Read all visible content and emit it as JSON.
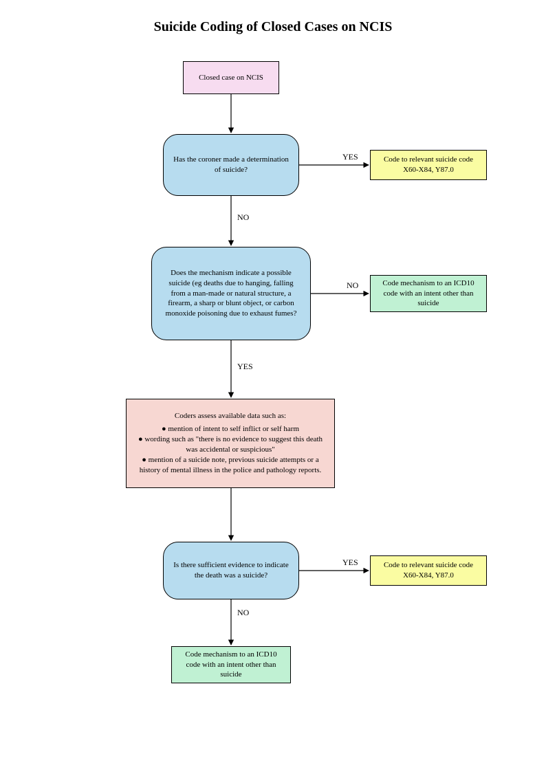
{
  "title": "Suicide Coding of Closed Cases on NCIS",
  "nodes": {
    "start": "Closed case on NCIS",
    "q1": "Has the coroner made a determination of suicide?",
    "r1": "Code to relevant suicide code X60-X84, Y87.0",
    "q2": "Does the mechanism indicate a possible suicide (eg deaths due to hanging, falling from a man-made or natural structure, a firearm, a sharp or blunt object, or carbon monoxide poisoning due to exhaust fumes?",
    "r2": "Code mechanism to an ICD10 code with an intent other than suicide",
    "assess_hdr": "Coders assess available data such as:",
    "assess_b1": "● mention of intent to self inflict or self harm",
    "assess_b2": "● wording such as \"there is no evidence to suggest this death was accidental or suspicious\"",
    "assess_b3": "● mention of a suicide note, previous suicide attempts or a history of mental illness in the police and pathology reports.",
    "q3": "Is there sufficient evidence to indicate the death was a suicide?",
    "r3": "Code to relevant suicide code X60-X84, Y87.0",
    "r4": "Code mechanism to an ICD10 code with an intent other than suicide"
  },
  "labels": {
    "yes": "YES",
    "no": "NO"
  }
}
